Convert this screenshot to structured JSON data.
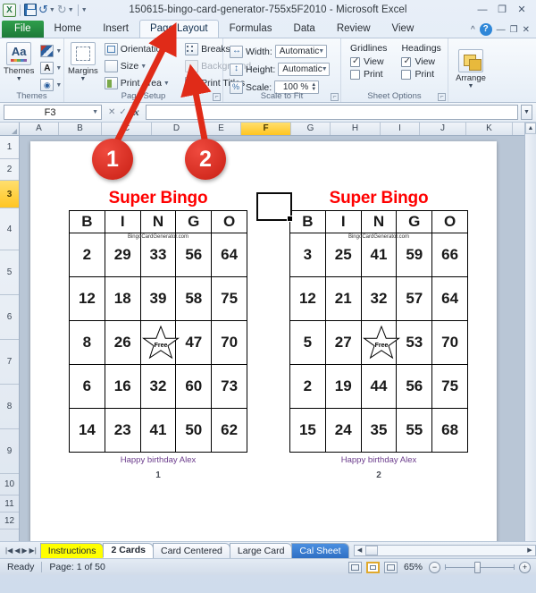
{
  "window": {
    "title": "150615-bingo-card-generator-755x5F2010  -  Microsoft Excel",
    "qat": [
      "excel-logo",
      "save",
      "undo",
      "redo",
      "customize"
    ],
    "minimize": "—",
    "restore": "❐",
    "close": "✕"
  },
  "ribbon": {
    "file_tab": "File",
    "tabs": [
      "Home",
      "Insert",
      "Page Layout",
      "Formulas",
      "Data",
      "Review",
      "View"
    ],
    "active_tab": "Page Layout",
    "help_label": "?",
    "minimize_ribbon": "^",
    "inner_minimize": "—",
    "inner_restore": "❐",
    "inner_close": "✕",
    "groups": [
      {
        "name": "Themes",
        "big": {
          "label": "Themes",
          "icon": "themes-icon"
        },
        "small": [
          {
            "label": "",
            "icon": "theme-colors-icon"
          },
          {
            "label": "",
            "icon": "theme-fonts-icon"
          },
          {
            "label": "",
            "icon": "theme-effects-icon"
          }
        ]
      },
      {
        "name": "Page Setup",
        "big": {
          "label": "Margins",
          "icon": "margins-icon"
        },
        "small": [
          {
            "label": "Orientation",
            "icon": "orientation-icon",
            "disabled": false
          },
          {
            "label": "Size",
            "icon": "size-icon",
            "disabled": false
          },
          {
            "label": "Print Area",
            "icon": "print-area-icon",
            "disabled": false
          },
          {
            "label": "Breaks",
            "icon": "breaks-icon",
            "disabled": false
          },
          {
            "label": "Background",
            "icon": "background-icon",
            "disabled": true
          },
          {
            "label": "Print Titles",
            "icon": "print-titles-icon",
            "disabled": false
          }
        ]
      },
      {
        "name": "Scale to Fit",
        "fields": [
          {
            "label": "Width:",
            "value": "Automatic",
            "icon": "width-icon"
          },
          {
            "label": "Height:",
            "value": "Automatic",
            "icon": "height-icon"
          },
          {
            "label": "Scale:",
            "value": "100 %",
            "icon": "scale-icon"
          }
        ]
      },
      {
        "name": "Sheet Options",
        "columns": [
          {
            "title": "Gridlines",
            "options": [
              {
                "label": "View",
                "checked": true
              },
              {
                "label": "Print",
                "checked": false
              }
            ]
          },
          {
            "title": "Headings",
            "options": [
              {
                "label": "View",
                "checked": true
              },
              {
                "label": "Print",
                "checked": false
              }
            ]
          }
        ]
      },
      {
        "name": "",
        "big": {
          "label": "Arrange",
          "icon": "arrange-icon"
        }
      }
    ]
  },
  "formula_bar": {
    "name_box": "F3",
    "formula": "",
    "fx_label": "fx",
    "placeholder": ""
  },
  "grid": {
    "columns": [
      "A",
      "B",
      "C",
      "D",
      "E",
      "F",
      "G",
      "H",
      "I",
      "J",
      "K"
    ],
    "selected_column": "F",
    "rows": [
      "1",
      "2",
      "3",
      "4",
      "5",
      "6",
      "7",
      "8",
      "9",
      "10",
      "11",
      "12"
    ],
    "selected_row": "3",
    "selected_cell": "F3"
  },
  "page_marks": {
    "top_left": "1",
    "top_mid_left": "1",
    "top_mid_right": "2",
    "top_right": "2",
    "inner_left": "1",
    "inner_right": "2",
    "bottom_left": "1",
    "bottom_mid_left": "1",
    "bottom_mid_right": "2",
    "bottom_right": "2",
    "card1_number": "1",
    "card2_number": "2"
  },
  "cards": [
    {
      "title": "Super Bingo",
      "watermark": "BingoCardGenerator.com",
      "headers": [
        "B",
        "I",
        "N",
        "G",
        "O"
      ],
      "grid": [
        [
          "2",
          "29",
          "33",
          "56",
          "64"
        ],
        [
          "12",
          "18",
          "39",
          "58",
          "75"
        ],
        [
          "8",
          "26",
          "Free",
          "47",
          "70"
        ],
        [
          "6",
          "16",
          "32",
          "60",
          "73"
        ],
        [
          "14",
          "23",
          "41",
          "50",
          "62"
        ]
      ],
      "free_label": "Free",
      "footer": "Happy birthday Alex",
      "number": "1"
    },
    {
      "title": "Super Bingo",
      "watermark": "BingoCardGenerator.com",
      "headers": [
        "B",
        "I",
        "N",
        "G",
        "O"
      ],
      "grid": [
        [
          "3",
          "25",
          "41",
          "59",
          "66"
        ],
        [
          "12",
          "21",
          "32",
          "57",
          "64"
        ],
        [
          "5",
          "27",
          "Free",
          "53",
          "70"
        ],
        [
          "2",
          "19",
          "44",
          "56",
          "75"
        ],
        [
          "15",
          "24",
          "35",
          "55",
          "68"
        ]
      ],
      "free_label": "Free",
      "footer": "Happy birthday Alex",
      "number": "2"
    }
  ],
  "callouts": [
    {
      "label": "1",
      "target": "page-layout-tab"
    },
    {
      "label": "2",
      "target": "print-titles-button"
    }
  ],
  "sheet_tabs": {
    "nav": [
      "|◀",
      "◀",
      "▶",
      "▶|"
    ],
    "tabs": [
      {
        "label": "Instructions",
        "style": "yellow"
      },
      {
        "label": "2 Cards",
        "style": "active"
      },
      {
        "label": "Card Centered",
        "style": "normal"
      },
      {
        "label": "Large Card",
        "style": "normal"
      },
      {
        "label": "Cal Sheet",
        "style": "blue"
      }
    ]
  },
  "status_bar": {
    "mode": "Ready",
    "page_info": "Page: 1 of 50",
    "zoom": "65%",
    "views": [
      "normal-view",
      "page-layout-view",
      "page-break-view"
    ],
    "active_view": "page-layout-view",
    "zoom_out": "−",
    "zoom_in": "+"
  },
  "colors": {
    "title_red": "#ff0000",
    "footer_purple": "#6b3c8c",
    "callout_red": "#c81f14",
    "tab_yellow": "#ffff00",
    "tab_blue": "#2f6fc4",
    "selection_gold": "#ffc522"
  }
}
